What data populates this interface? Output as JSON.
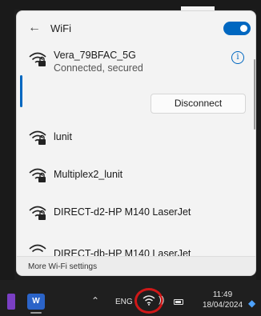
{
  "wifi_panel": {
    "title": "WiFi",
    "toggle_on": true,
    "connected_network": {
      "name": "Vera_79BFAC_5G",
      "status": "Connected, secured",
      "disconnect_label": "Disconnect"
    },
    "networks": [
      {
        "name": "lunit"
      },
      {
        "name": "Multiplex2_lunit"
      },
      {
        "name": "DIRECT-d2-HP M140 LaserJet"
      },
      {
        "name": "DIRECT-db-HP M140 LaserJet"
      }
    ],
    "footer_link": "More Wi-Fi settings"
  },
  "taskbar": {
    "word_icon_letter": "W",
    "language": "ENG",
    "time": "11:49",
    "date": "18/04/2024",
    "highlight_color": "#d01818"
  },
  "colors": {
    "accent": "#0067c0",
    "panel_bg": "#f3f3f3"
  }
}
